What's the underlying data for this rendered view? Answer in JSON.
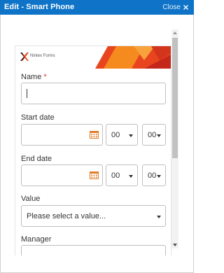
{
  "window": {
    "title": "Edit - Smart Phone",
    "close_label": "Close",
    "accent_color": "#0f74c7"
  },
  "banner": {
    "logo_text": "Nintex Forms",
    "logo_icon": "nintex-x-logo",
    "accent_colors": [
      "#e8451e",
      "#f58a1f",
      "#c4281a"
    ]
  },
  "form": {
    "name": {
      "label": "Name",
      "required_marker": "*",
      "value": ""
    },
    "start_date": {
      "label": "Start date",
      "value": "",
      "hour": "00",
      "minute": "00"
    },
    "end_date": {
      "label": "End date",
      "value": "",
      "hour": "00",
      "minute": "00"
    },
    "value": {
      "label": "Value",
      "selected": "Please select a value..."
    },
    "manager": {
      "label": "Manager"
    }
  },
  "icons": {
    "calendar": "calendar-icon",
    "close": "close-icon",
    "dropdown": "chevron-down-icon"
  }
}
